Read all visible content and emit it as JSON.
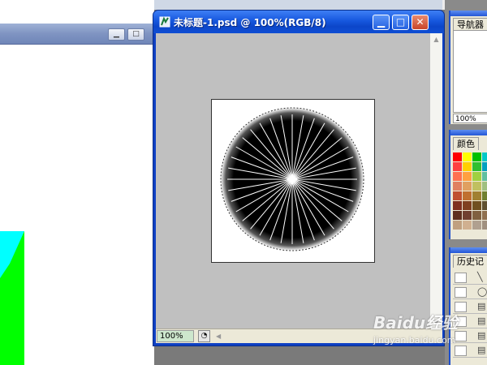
{
  "document": {
    "title": "未标题-1.psd @ 100%(RGB/8)",
    "zoom": "100%",
    "buttons": {
      "minimize": "▁",
      "maximize": "□",
      "close": "✕"
    }
  },
  "background_window": {
    "buttons": {
      "minimize": "▁",
      "maximize": "□"
    }
  },
  "panels": {
    "navigator": {
      "tab_label": "导航器",
      "zoom": "100%"
    },
    "color": {
      "tab_label": "颜色"
    },
    "history": {
      "tab_label": "历史记"
    }
  },
  "swatch_colors": [
    "#ff0000",
    "#ffff00",
    "#00c000",
    "#00c8c8",
    "#ff4040",
    "#ffd000",
    "#30c030",
    "#00a0c0",
    "#ff7050",
    "#ffa040",
    "#a0d040",
    "#60c0a0",
    "#e08060",
    "#e0a060",
    "#c0c060",
    "#a0c080",
    "#c05030",
    "#c07030",
    "#a08030",
    "#708030",
    "#803020",
    "#804020",
    "#705020",
    "#605030",
    "#603020",
    "#704030",
    "#806040",
    "#907050",
    "#c0a080",
    "#d0b090",
    "#b0a090",
    "#a09080"
  ],
  "watermark": {
    "brand": "Baidu经验",
    "url": "jingyan.baidu.com"
  },
  "canvas_graphic": {
    "rays": 36
  }
}
